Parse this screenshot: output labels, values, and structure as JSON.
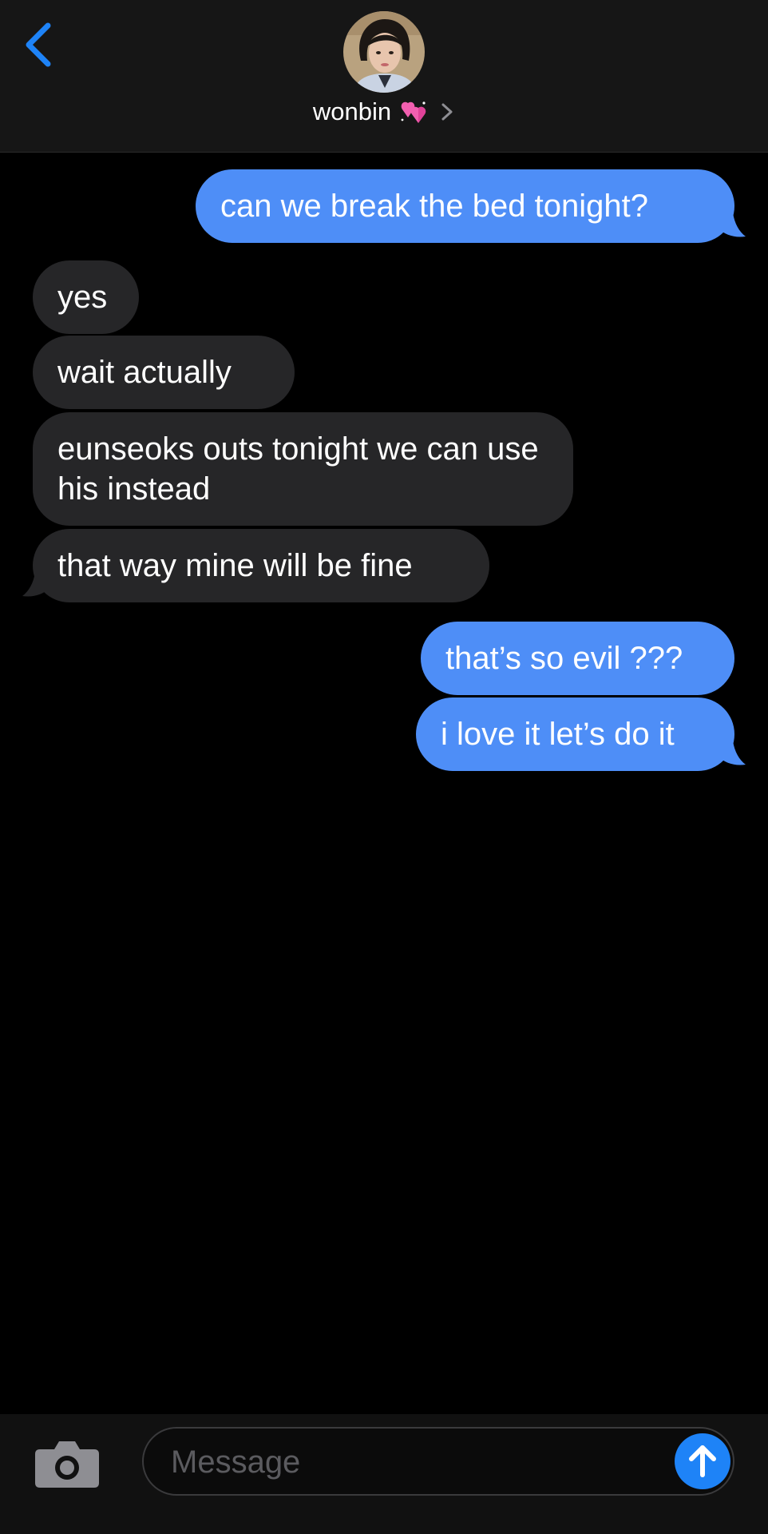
{
  "header": {
    "contact_name": "wonbin",
    "avatar_icon": "contact-avatar-photo",
    "name_emoji": "two-hearts-emoji",
    "back_icon": "chevron-left-icon",
    "details_icon": "chevron-right-icon"
  },
  "messages": [
    {
      "direction": "sent",
      "text": "can we break the bed tonight?"
    },
    {
      "direction": "received",
      "text": "yes"
    },
    {
      "direction": "received",
      "text": "wait actually"
    },
    {
      "direction": "received",
      "text": "eunseoks outs tonight we can use his instead"
    },
    {
      "direction": "received",
      "text": "that way mine will be fine"
    },
    {
      "direction": "sent",
      "text": "that’s so evil ???"
    },
    {
      "direction": "sent",
      "text": "i love it let’s do it"
    }
  ],
  "input_bar": {
    "placeholder": "Message",
    "value": "",
    "camera_icon": "camera-icon",
    "send_icon": "arrow-up-icon"
  },
  "colors": {
    "accent": "#1e83f7",
    "sent_bubble": "#4e8ef7",
    "received_bubble": "#262628",
    "background": "#000000",
    "header_background": "#161616"
  }
}
